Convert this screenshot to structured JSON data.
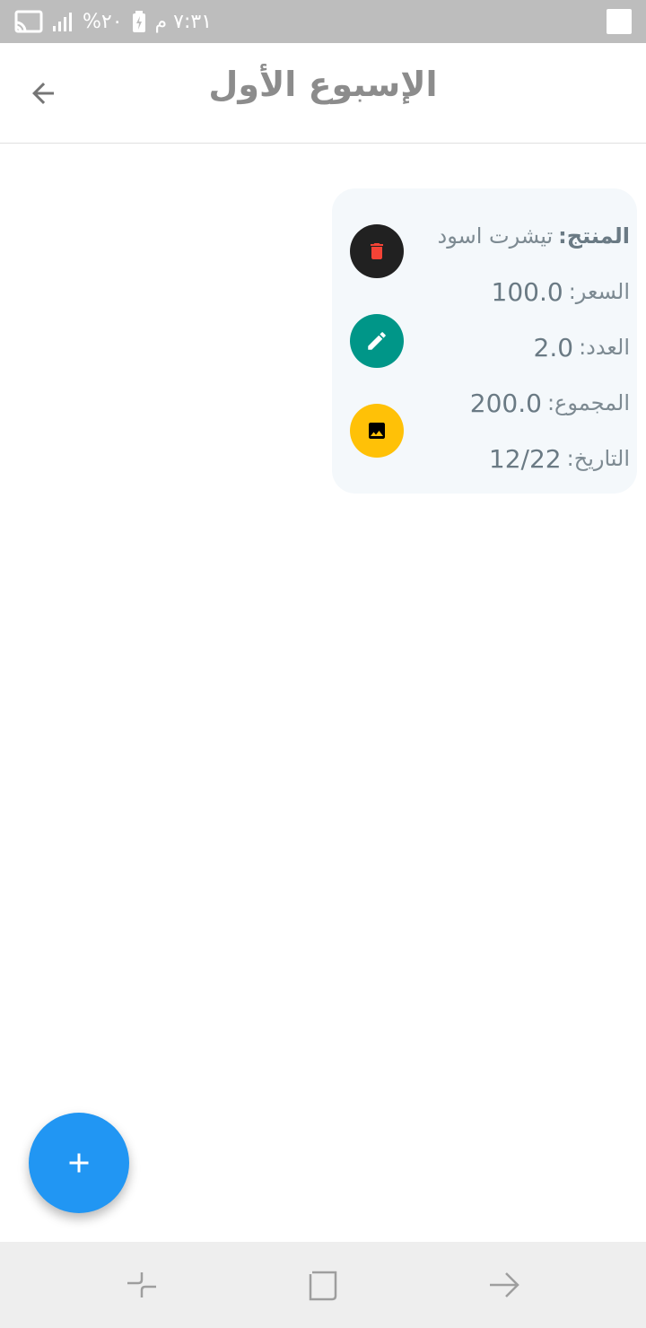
{
  "status_bar": {
    "time": "٧:٣١ م",
    "battery": "٢٠%"
  },
  "app_bar": {
    "title": "الإسبوع الأول"
  },
  "record": {
    "product_label": "المنتج:",
    "product_value": "تيشرت اسود",
    "price_label": "السعر:",
    "price_value": "100.0",
    "count_label": "العدد:",
    "count_value": "2.0",
    "total_label": "المجموع:",
    "total_value": "200.0",
    "date_label": "التاريخ:",
    "date_value": "12/22"
  },
  "icons": {
    "back": "arrow-back-icon",
    "delete": "trash-icon",
    "edit": "pencil-icon",
    "image": "image-icon",
    "add": "plus-icon"
  },
  "colors": {
    "delete_bg": "#212121",
    "delete_icon": "#f44336",
    "edit_bg": "#009688",
    "image_bg": "#ffc107",
    "fab": "#2196f3"
  }
}
